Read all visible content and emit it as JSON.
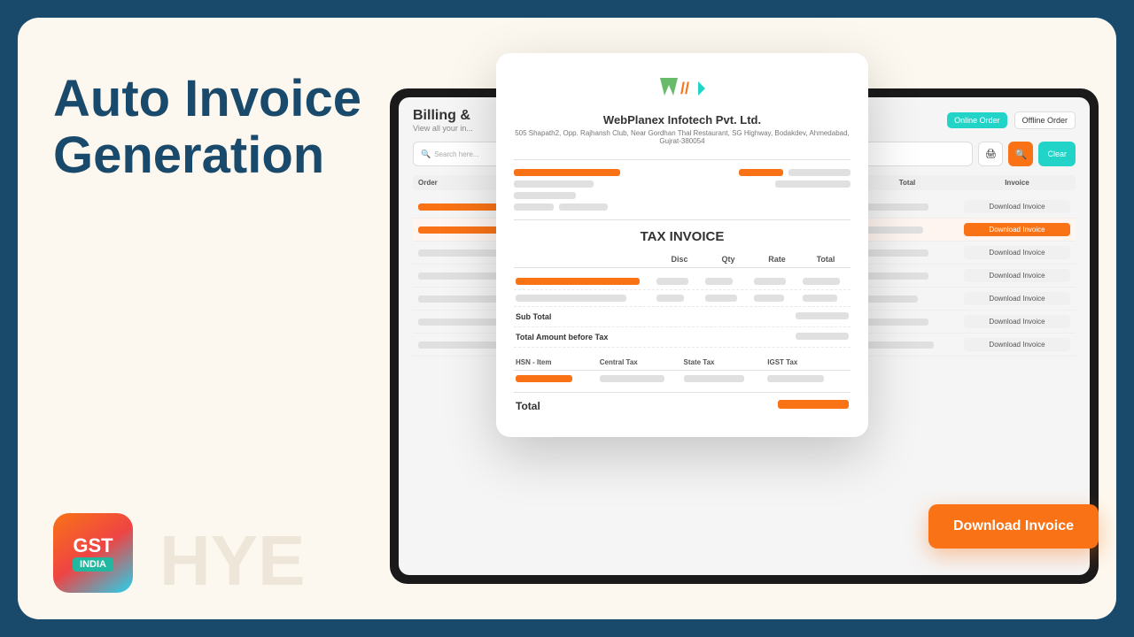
{
  "background": {
    "outer": "#1a4a6b",
    "inner": "#fdf8ef"
  },
  "left_panel": {
    "title_line1": "Auto Invoice",
    "title_line2": "Generation"
  },
  "gst_badge": {
    "line1": "GST",
    "line2": "INDIA"
  },
  "back_tablet": {
    "header": {
      "title": "Billing &",
      "subtitle": "View all your in..."
    },
    "buttons": {
      "online": "Online Order",
      "offline": "Offline Order",
      "clear": "Clear"
    },
    "table": {
      "columns": [
        "Order",
        "Total",
        "Invoice"
      ],
      "download_label": "Download Invoice"
    }
  },
  "invoice_modal": {
    "company": {
      "name": "WebPlanex Infotech Pvt. Ltd.",
      "address": "505 Shapath2, Opp. Rajhansh Club, Near Gordhan Thal Restaurant, SG Highway, Bodakdev, Ahmedabad, Gujrat-380054"
    },
    "title": "TAX INVOICE",
    "table": {
      "columns": [
        "",
        "Disc",
        "Qty",
        "Rate",
        "Total"
      ]
    },
    "subtotal_label": "Sub Total",
    "total_before_tax_label": "Total Amount before Tax",
    "tax_section": {
      "columns": [
        "HSN - Item",
        "Central Tax",
        "State Tax",
        "IGST Tax"
      ]
    },
    "total_label": "Total"
  },
  "download_button": {
    "label": "Download Invoice"
  },
  "download_invoice_rows": {
    "label": "Download Invoice"
  }
}
